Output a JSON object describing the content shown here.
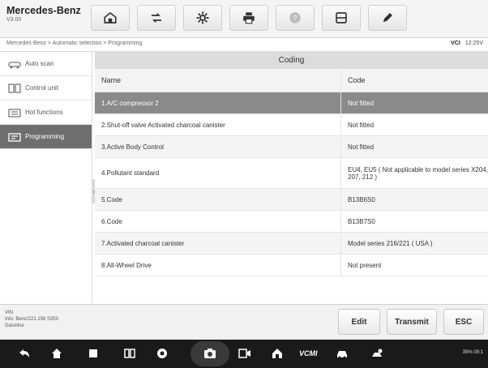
{
  "app": {
    "brand": "Mercedes-Benz",
    "version": "V3.00"
  },
  "toolbar": {
    "buttons": [
      {
        "name": "home-icon"
      },
      {
        "name": "vehicle-swap-icon"
      },
      {
        "name": "settings-icon"
      },
      {
        "name": "printer-icon"
      },
      {
        "name": "help-icon"
      },
      {
        "name": "save-icon"
      },
      {
        "name": "edit-icon"
      }
    ]
  },
  "breadcrumb": "Mercedes-Benz > Automatic selection > Programming",
  "status": {
    "vci": "VCI",
    "time": "12:25V"
  },
  "sidebar": {
    "items": [
      {
        "label": "Auto scan",
        "icon": "car-scan-icon",
        "active": false
      },
      {
        "label": "Control unit",
        "icon": "control-unit-icon",
        "active": false
      },
      {
        "label": "Hot functions",
        "icon": "hot-functions-icon",
        "active": false
      },
      {
        "label": "Programming",
        "icon": "programming-icon",
        "active": true
      }
    ]
  },
  "table": {
    "title": "Coding",
    "headers": {
      "name": "Name",
      "code": "Code"
    },
    "rows": [
      {
        "name": "1.A/C compressor 2",
        "code": "Not fitted"
      },
      {
        "name": "2.Shut-off valve Activated charcoal canister",
        "code": "Not fitted"
      },
      {
        "name": "3.Active Body Control",
        "code": "Not fitted"
      },
      {
        "name": "4.Pollutant standard",
        "code": "EU4, EU5 ( Not applicable to model series X204, 207, 212 )"
      },
      {
        "name": "5.Code",
        "code": "B13B6S0"
      },
      {
        "name": "6.Code",
        "code": "B13B7S0"
      },
      {
        "name": "7.Activated charcoal canister",
        "code": "Model series 216/221 ( USA )"
      },
      {
        "name": "8.All-Wheel Drive",
        "code": "Not present"
      }
    ]
  },
  "vehicle_info": {
    "line1": "VIN",
    "line2": "Info: Benz/221.156 S350",
    "line3": "Gasoline"
  },
  "actions": {
    "edit": "Edit",
    "transmit": "Transmit",
    "esc": "ESC"
  },
  "navbar": {
    "vcmi": "VCMI",
    "status": "39% 09:1"
  }
}
